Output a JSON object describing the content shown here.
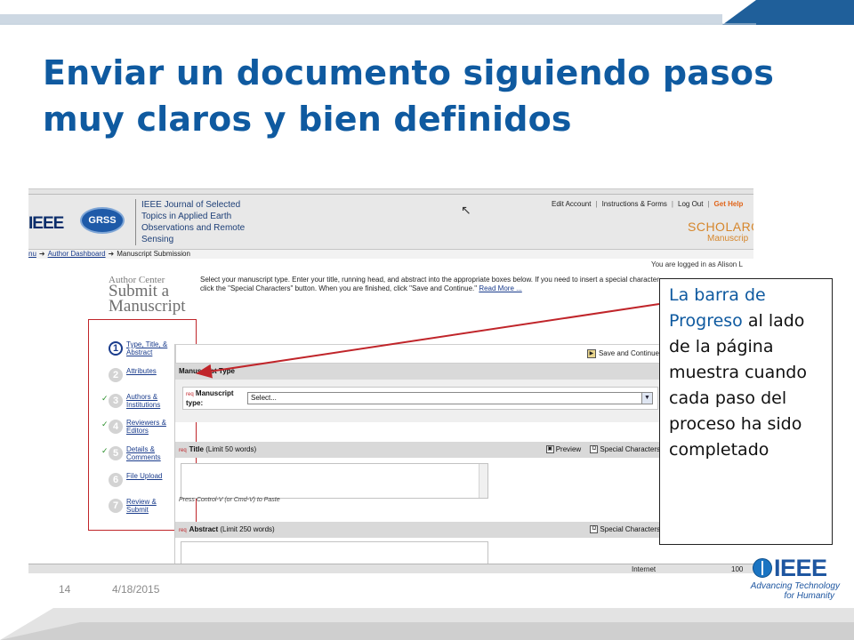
{
  "slide": {
    "title": "Enviar un documento siguiendo pasos muy claros y bien definidos",
    "number": "14",
    "date": "4/18/2015",
    "accent_color": "#0f5aa0"
  },
  "screenshot": {
    "brand_left": "IEEE",
    "society_logo": "GRSS",
    "journal_name": "IEEE Journal of Selected Topics in Applied Earth Observations and Remote Sensing",
    "top_links": [
      "Edit Account",
      "Instructions & Forms",
      "Log Out",
      "Get Help"
    ],
    "scholarone_name": "SCHOLARON",
    "scholarone_sub": "Manuscrip",
    "breadcrumb": [
      "nu",
      "Author Dashboard",
      "Manuscript Submission"
    ],
    "logged_in": "You are logged in as Alison L",
    "author_center": "Author Center",
    "submit_title": "Submit a Manuscript",
    "instructions": "Select your manuscript type. Enter your title, running head, and abstract into the appropriate boxes below. If you need to insert a special character, click the \"Special Characters\" button. When you are finished, click \"Save and Continue.\"",
    "read_more": "Read More ...",
    "steps": [
      {
        "num": "1",
        "label": "Type, Title, & Abstract",
        "done": false,
        "current": true
      },
      {
        "num": "2",
        "label": "Attributes",
        "done": false,
        "current": false
      },
      {
        "num": "3",
        "label": "Authors & Institutions",
        "done": true,
        "current": false
      },
      {
        "num": "4",
        "label": "Reviewers & Editors",
        "done": true,
        "current": false
      },
      {
        "num": "5",
        "label": "Details & Comments",
        "done": true,
        "current": false
      },
      {
        "num": "6",
        "label": "File Upload",
        "done": false,
        "current": false
      },
      {
        "num": "7",
        "label": "Review & Submit",
        "done": false,
        "current": false
      }
    ],
    "save_continue": "Save and Continue",
    "manuscript_type_header": "Manuscript Type",
    "req_tag": "req",
    "manuscript_type_label": "Manuscript type:",
    "manuscript_type_value": "Select...",
    "title_header": "Title",
    "title_limit": "(Limit 50 words)",
    "preview": "Preview",
    "special_characters": "Special Characters",
    "paste_note": "Press Control-V (or Cmd-V) to Paste",
    "abstract_header": "Abstract",
    "abstract_limit": "(Limit 250 words)",
    "status_internet": "Internet",
    "status_zoom": "100"
  },
  "callout": {
    "highlight": "La barra de Progreso",
    "rest": " al lado de la página muestra cuando cada paso del proceso ha sido completado"
  },
  "ieee_logo": {
    "word": "IEEE",
    "tagline_1": "Advancing Technology",
    "tagline_2": "for Humanity"
  }
}
